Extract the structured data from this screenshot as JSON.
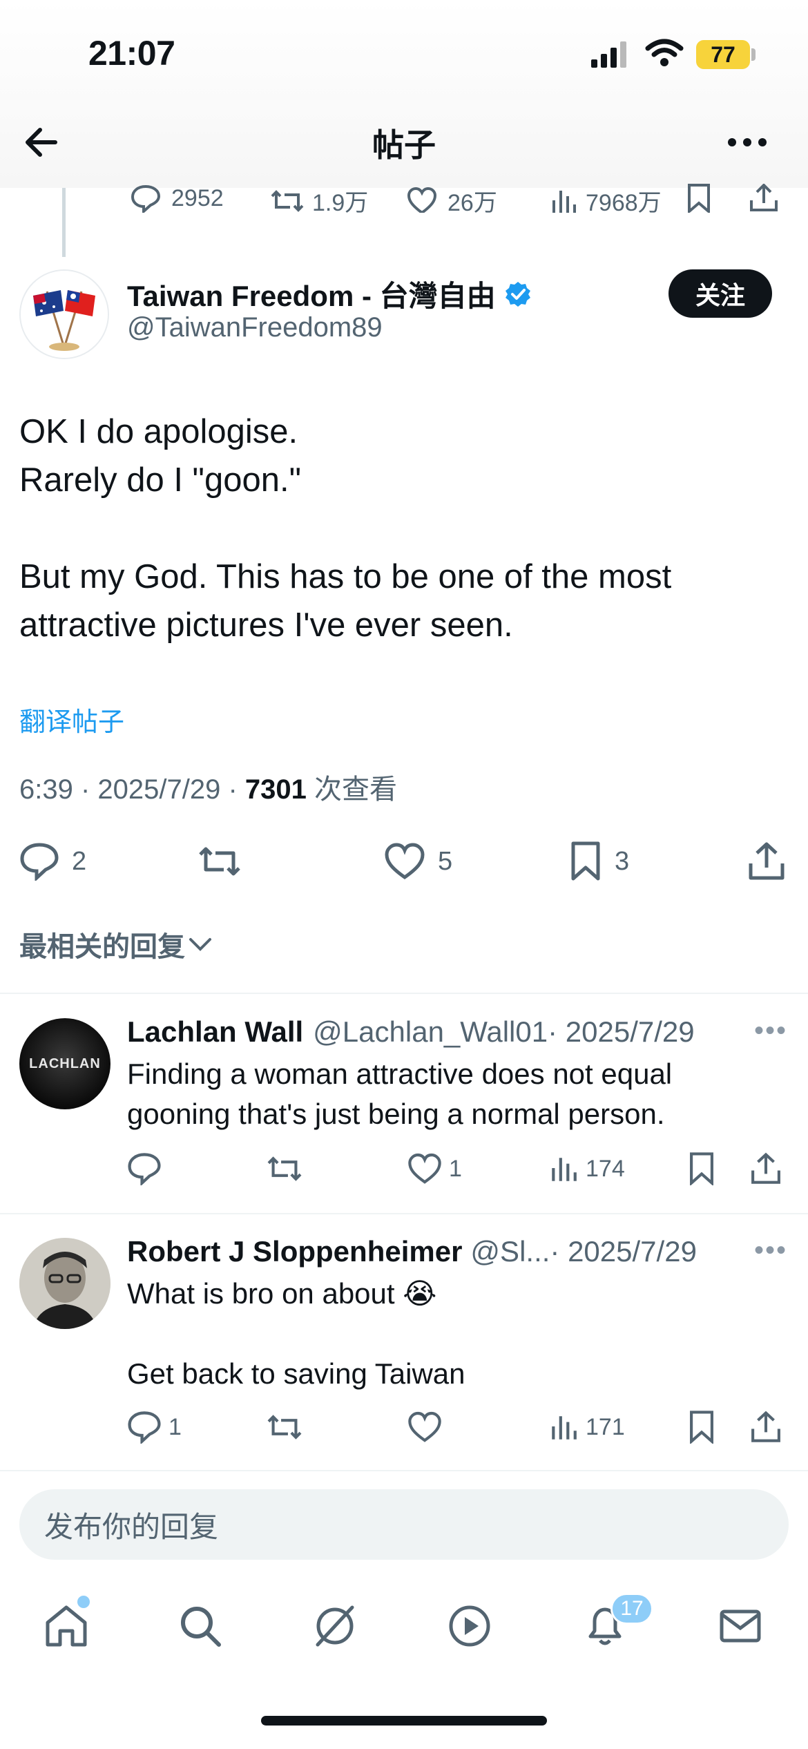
{
  "status_bar": {
    "time": "21:07",
    "battery": "77"
  },
  "header": {
    "title": "帖子"
  },
  "parent_stats": {
    "replies": "2952",
    "reposts": "1.9万",
    "likes": "26万",
    "views": "7968万"
  },
  "post": {
    "author_name": "Taiwan Freedom - 台灣自由",
    "author_handle": "@TaiwanFreedom89",
    "follow_label": "关注",
    "text": "OK I do apologise.\nRarely do I \"goon.\"\n\nBut my God. This has to be one of the most attractive pictures I've ever seen.",
    "translate_label": "翻译帖子",
    "timestamp": "6:39 · 2025/7/29 · ",
    "views_count": "7301",
    "views_label": " 次查看",
    "stats": {
      "replies": "2",
      "likes": "5",
      "bookmarks": "3"
    }
  },
  "sort_label": "最相关的回复",
  "replies": [
    {
      "name": "Lachlan Wall",
      "handle": "@Lachlan_Wall01",
      "date": " · 2025/7/29",
      "avatar_text": "LACHLAN",
      "text": "Finding a woman attractive does not equal\ngooning  that's just being a normal person.",
      "stats": {
        "replies": "",
        "likes": "1",
        "views": "174"
      }
    },
    {
      "name": "Robert J Sloppenheimer",
      "handle": "@Sl...",
      "date": " · 2025/7/29",
      "text": "What is bro on about 😭\n\nGet back to saving Taiwan",
      "stats": {
        "replies": "1",
        "likes": "",
        "views": "171"
      }
    }
  ],
  "composer": {
    "placeholder": "发布你的回复"
  },
  "tabbar": {
    "notifications_badge": "17"
  },
  "colors": {
    "accent": "#1d9bf0",
    "text": "#0f1419",
    "muted": "#536471",
    "battery": "#f7d33b"
  }
}
